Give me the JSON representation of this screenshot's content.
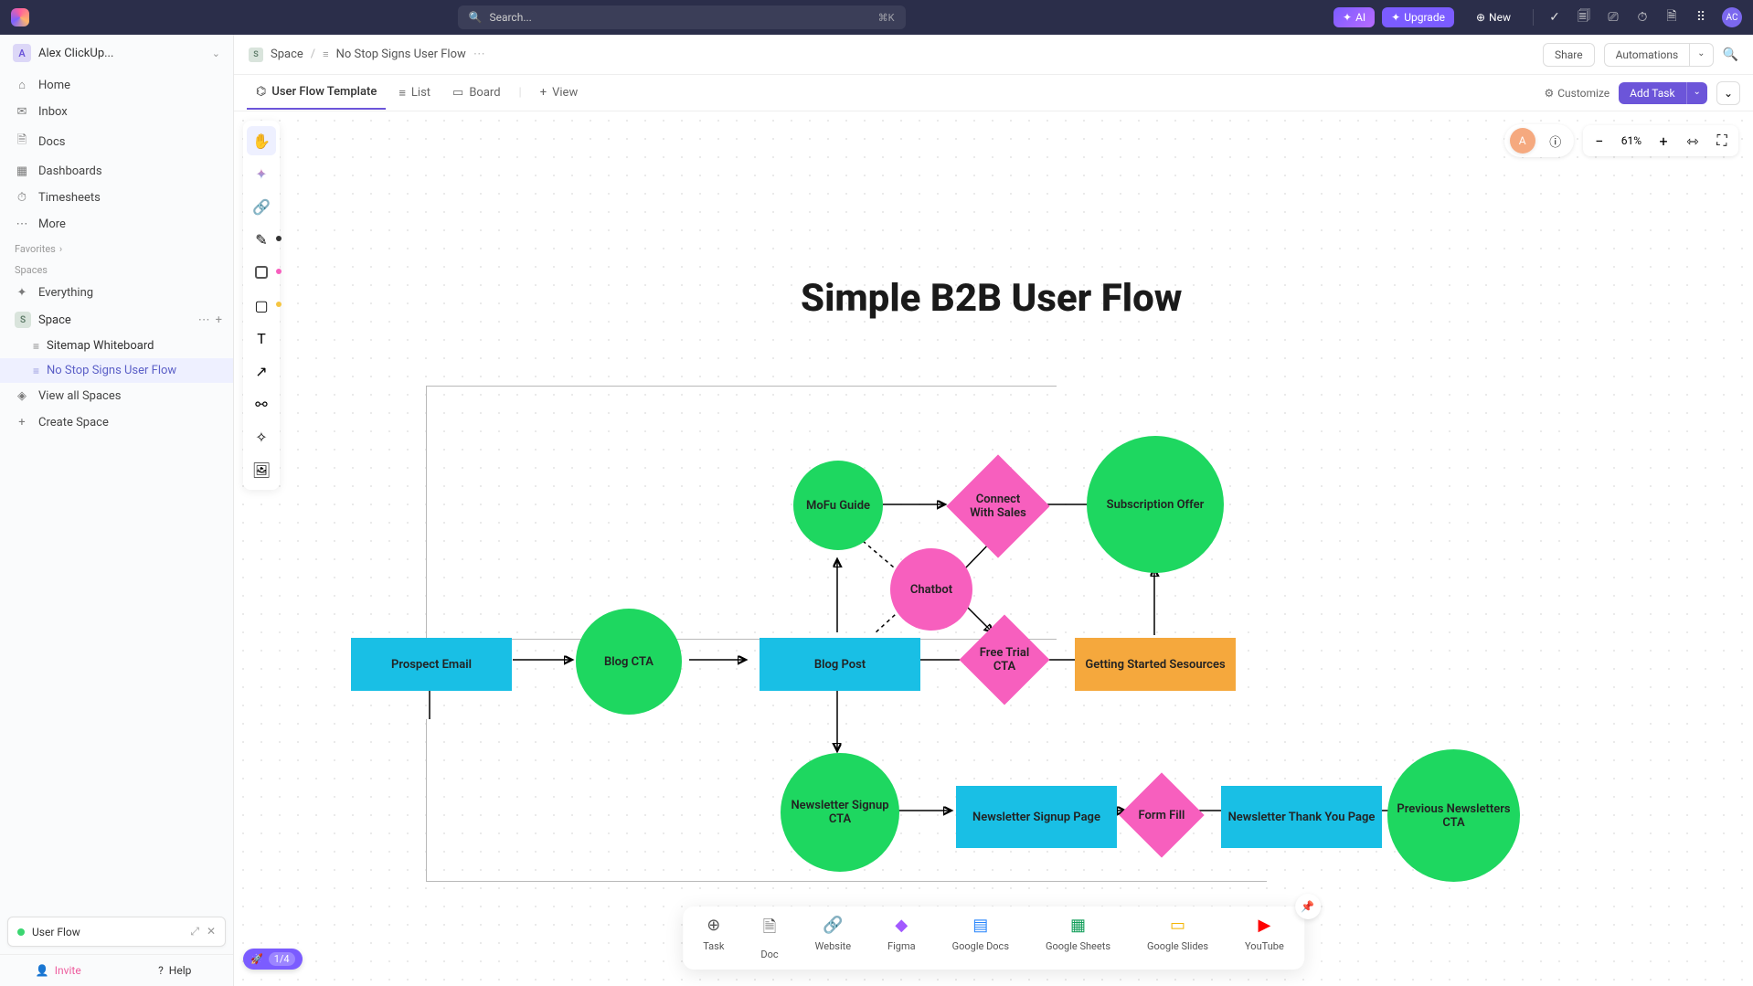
{
  "topbar": {
    "search_placeholder": "Search...",
    "search_kbd": "⌘K",
    "ai_label": "AI",
    "upgrade_label": "Upgrade",
    "new_label": "New",
    "avatar_initials": "AC"
  },
  "workspace": {
    "initial": "A",
    "name": "Alex ClickUp..."
  },
  "sidebar": {
    "nav": [
      {
        "icon": "⌂",
        "label": "Home"
      },
      {
        "icon": "✉",
        "label": "Inbox"
      },
      {
        "icon": "🗎",
        "label": "Docs"
      },
      {
        "icon": "▦",
        "label": "Dashboards"
      },
      {
        "icon": "⏱",
        "label": "Timesheets"
      },
      {
        "icon": "⋯",
        "label": "More"
      }
    ],
    "favorites_label": "Favorites",
    "spaces_label": "Spaces",
    "everything_label": "Everything",
    "space_initial": "S",
    "space_name": "Space",
    "lists": [
      {
        "label": "Sitemap Whiteboard",
        "active": false
      },
      {
        "label": "No Stop Signs User Flow",
        "active": true
      }
    ],
    "view_all_label": "View all Spaces",
    "create_space_label": "Create Space",
    "toast_label": "User Flow",
    "invite_label": "Invite",
    "help_label": "Help"
  },
  "breadcrumb": {
    "space_initial": "S",
    "space": "Space",
    "page": "No Stop Signs User Flow",
    "share": "Share",
    "automations": "Automations"
  },
  "tabs": {
    "items": [
      {
        "icon": "⌬",
        "label": "User Flow Template",
        "active": true
      },
      {
        "icon": "≡",
        "label": "List"
      },
      {
        "icon": "▭",
        "label": "Board"
      }
    ],
    "add_view": "View",
    "customize": "Customize",
    "add_task": "Add Task"
  },
  "zoom": {
    "level": "61%"
  },
  "diagram": {
    "title": "Simple B2B User Flow",
    "nodes": {
      "prospect_email": "Prospect Email",
      "blog_cta": "Blog CTA",
      "mofu_guide": "MoFu Guide",
      "blog_post": "Blog Post",
      "chatbot": "Chatbot",
      "connect_sales": "Connect With Sales",
      "subscription_offer": "Subscription Offer",
      "free_trial": "Free Trial CTA",
      "getting_started": "Getting Started Sesources",
      "newsletter_signup_cta": "Newsletter Signup CTA",
      "newsletter_signup_page": "Newsletter Signup Page",
      "form_fill": "Form Fill",
      "newsletter_thank_you": "Newsletter Thank You Page",
      "previous_newsletters": "Previous Newsletters CTA"
    }
  },
  "dock": {
    "items": [
      {
        "icon": "⊕",
        "label": "Task",
        "color": "#555"
      },
      {
        "icon": "🗎",
        "label": "Doc",
        "color": "#555"
      },
      {
        "icon": "🔗",
        "label": "Website",
        "color": "#555"
      },
      {
        "icon": "◆",
        "label": "Figma",
        "color": "#a259ff"
      },
      {
        "icon": "▤",
        "label": "Google Docs",
        "color": "#2684fc"
      },
      {
        "icon": "▦",
        "label": "Google Sheets",
        "color": "#0f9d58"
      },
      {
        "icon": "▭",
        "label": "Google Slides",
        "color": "#f4b400"
      },
      {
        "icon": "▶",
        "label": "YouTube",
        "color": "#ff0000"
      }
    ]
  },
  "progress": {
    "count": "1/4"
  },
  "presence": {
    "initial": "A"
  }
}
